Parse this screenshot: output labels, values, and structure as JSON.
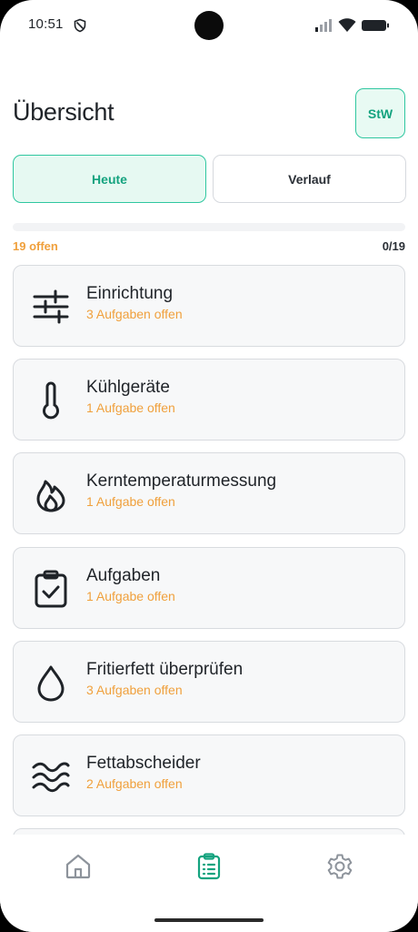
{
  "status_bar": {
    "time": "10:51"
  },
  "header": {
    "title": "Übersicht",
    "avatar_initials": "StW"
  },
  "segments": {
    "today": "Heute",
    "history": "Verlauf"
  },
  "progress": {
    "open_label": "19 offen",
    "ratio_label": "0/19",
    "done": 0,
    "total": 19
  },
  "cards": [
    {
      "title": "Einrichtung",
      "subtitle": "3 Aufgaben offen",
      "icon": "sliders-icon"
    },
    {
      "title": "Kühlgeräte",
      "subtitle": "1 Aufgabe offen",
      "icon": "thermometer-icon"
    },
    {
      "title": "Kerntemperaturmessung",
      "subtitle": "1 Aufgabe offen",
      "icon": "flame-icon"
    },
    {
      "title": "Aufgaben",
      "subtitle": "1 Aufgabe offen",
      "icon": "clipboard-check-icon"
    },
    {
      "title": "Fritierfett überprüfen",
      "subtitle": "3 Aufgaben offen",
      "icon": "droplet-icon"
    },
    {
      "title": "Fettabscheider",
      "subtitle": "2 Aufgaben offen",
      "icon": "waves-icon"
    }
  ],
  "nav": {
    "active": "tasks",
    "items": [
      "home-icon",
      "clipboard-list-icon",
      "gear-icon"
    ]
  },
  "colors": {
    "accent": "#2fc7a0",
    "accent_text": "#14a37f",
    "warning": "#f0a03c",
    "card_bg": "#f7f8f9"
  }
}
